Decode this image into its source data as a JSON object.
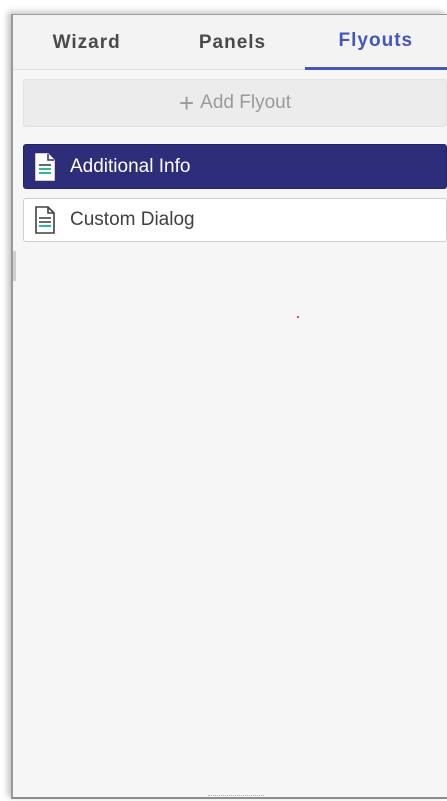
{
  "tabs": [
    {
      "label": "Wizard",
      "active": false
    },
    {
      "label": "Panels",
      "active": false
    },
    {
      "label": "Flyouts",
      "active": true
    }
  ],
  "add_button": {
    "label": "Add Flyout",
    "icon": "plus-icon"
  },
  "flyouts": [
    {
      "label": "Additional Info",
      "icon": "document-icon",
      "selected": true
    },
    {
      "label": "Custom Dialog",
      "icon": "document-icon",
      "selected": false
    }
  ],
  "colors": {
    "accent": "#4556b8",
    "selected_bg": "#2e2d79",
    "doc_icon_accent": "#2fb89a"
  }
}
